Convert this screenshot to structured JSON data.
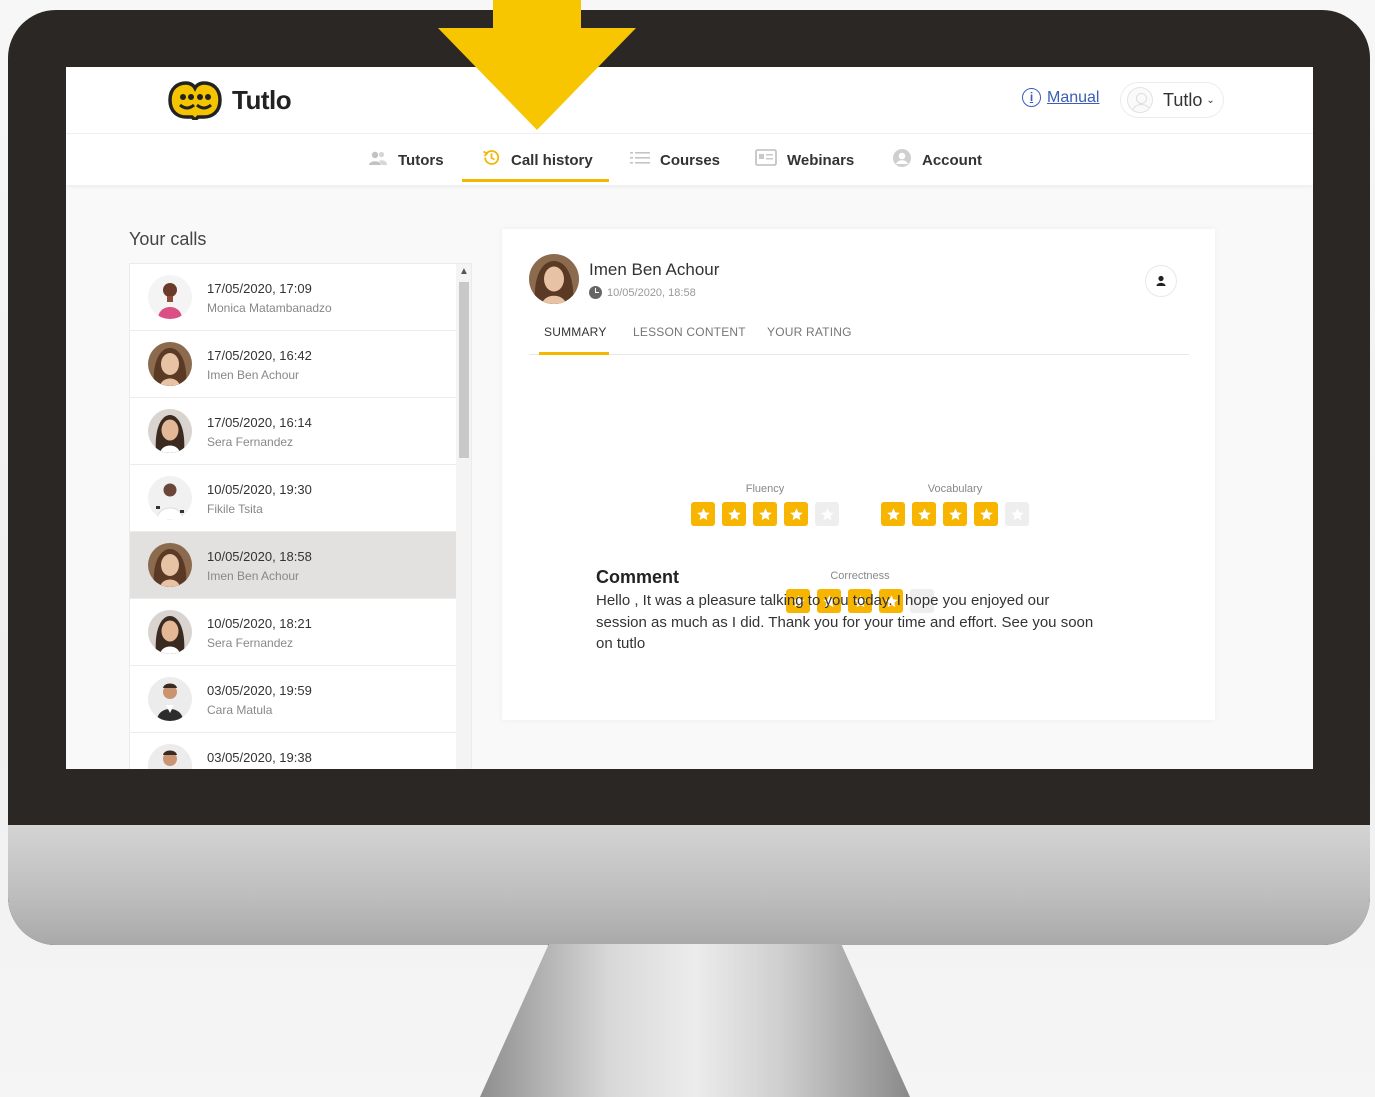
{
  "app": {
    "name": "Tutlo"
  },
  "header": {
    "manual_label": "Manual",
    "user_label": "Tutlo"
  },
  "nav": [
    {
      "label": "Tutors",
      "icon": "users-icon",
      "active": false
    },
    {
      "label": "Call history",
      "icon": "history-icon",
      "active": true
    },
    {
      "label": "Courses",
      "icon": "list-icon",
      "active": false
    },
    {
      "label": "Webinars",
      "icon": "webinar-icon",
      "active": false
    },
    {
      "label": "Account",
      "icon": "user-icon",
      "active": false
    }
  ],
  "calls": {
    "title": "Your calls",
    "items": [
      {
        "date": "17/05/2020, 17:09",
        "name": "Monica Matambanadzo",
        "selected": false
      },
      {
        "date": "17/05/2020, 16:42",
        "name": "Imen Ben Achour",
        "selected": false
      },
      {
        "date": "17/05/2020, 16:14",
        "name": "Sera Fernandez",
        "selected": false
      },
      {
        "date": "10/05/2020, 19:30",
        "name": "Fikile Tsita",
        "selected": false
      },
      {
        "date": "10/05/2020, 18:58",
        "name": "Imen Ben Achour",
        "selected": true
      },
      {
        "date": "10/05/2020, 18:21",
        "name": "Sera Fernandez",
        "selected": false
      },
      {
        "date": "03/05/2020, 19:59",
        "name": "Cara Matula",
        "selected": false
      },
      {
        "date": "03/05/2020, 19:38",
        "name": "",
        "selected": false
      }
    ]
  },
  "detail": {
    "tutor_name": "Imen Ben Achour",
    "call_time": "10/05/2020, 18:58",
    "tabs": [
      "SUMMARY",
      "LESSON CONTENT",
      "YOUR RATING"
    ],
    "active_tab": "SUMMARY",
    "ratings": [
      {
        "label": "Fluency",
        "stars": 4,
        "max": 5
      },
      {
        "label": "Vocabulary",
        "stars": 4,
        "max": 5
      },
      {
        "label": "Correctness",
        "stars": 4,
        "max": 5
      }
    ],
    "comment_title": "Comment",
    "comment": "Hello , It was a pleasure talking to you today. I hope you enjoyed our session as much as I did. Thank you for your time and effort. See you soon on tutlo"
  },
  "colors": {
    "accent": "#f5b800",
    "link": "#3b5cb8",
    "selected_row": "#e3e1df",
    "bezel": "#2a2725"
  }
}
